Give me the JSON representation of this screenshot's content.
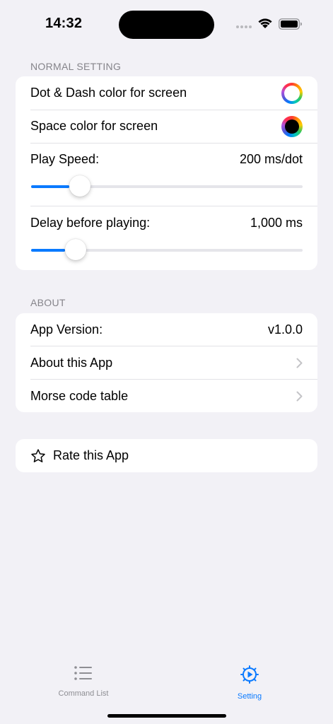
{
  "status": {
    "time": "14:32"
  },
  "normal": {
    "header": "NORMAL SETTING",
    "dot_dash_label": "Dot & Dash color for screen",
    "space_label": "Space color for screen",
    "speed_label": "Play Speed:",
    "speed_value": "200 ms/dot",
    "speed_fraction": 0.14,
    "delay_label": "Delay before playing:",
    "delay_value": "1,000 ms",
    "delay_fraction": 0.125
  },
  "about": {
    "header": "ABOUT",
    "version_label": "App Version:",
    "version_value": "v1.0.0",
    "about_label": "About this App",
    "morse_label": "Morse code table"
  },
  "rate": {
    "label": "Rate this App"
  },
  "tabs": [
    {
      "label": "Command List",
      "icon": "list-icon",
      "active": false
    },
    {
      "label": "Setting",
      "icon": "gear-play-icon",
      "active": true
    }
  ],
  "colors": {
    "accent": "#0a7aff",
    "inactive": "#8e8e93",
    "background": "#f2f1f6"
  }
}
